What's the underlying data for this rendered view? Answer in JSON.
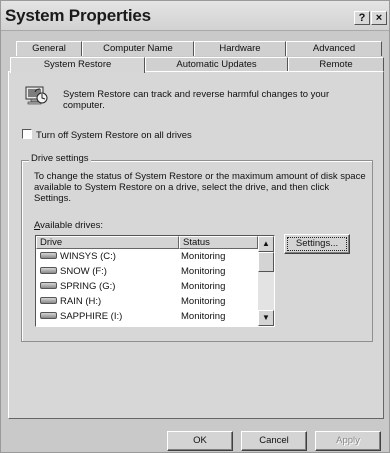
{
  "window": {
    "title": "System Properties",
    "help_glyph": "?",
    "close_glyph": "×"
  },
  "tabs_back": [
    {
      "label": "General"
    },
    {
      "label": "Computer Name"
    },
    {
      "label": "Hardware"
    },
    {
      "label": "Advanced"
    }
  ],
  "tabs_front": [
    {
      "label": "System Restore",
      "active": true
    },
    {
      "label": "Automatic Updates"
    },
    {
      "label": "Remote"
    }
  ],
  "intro_text": "System Restore can track and reverse harmful changes to your computer.",
  "turn_off_label": "Turn off System Restore on all drives",
  "turn_off_checked": false,
  "drive_settings": {
    "group_label": "Drive settings",
    "description": "To change the status of System Restore or the maximum amount of disk space available to System Restore on a drive, select the drive, and then click Settings.",
    "available_label": "Available drives:",
    "columns": {
      "drive": "Drive",
      "status": "Status"
    },
    "drives": [
      {
        "name": "WINSYS (C:)",
        "status": "Monitoring"
      },
      {
        "name": "SNOW (F:)",
        "status": "Monitoring"
      },
      {
        "name": "SPRING (G:)",
        "status": "Monitoring"
      },
      {
        "name": "RAIN (H:)",
        "status": "Monitoring"
      },
      {
        "name": "SAPPHIRE (I:)",
        "status": "Monitoring"
      }
    ],
    "settings_button": "Settings..."
  },
  "buttons": {
    "ok": "OK",
    "cancel": "Cancel",
    "apply": "Apply"
  },
  "icons": {
    "restore": "system-restore-icon",
    "drive": "hard-drive-icon"
  }
}
